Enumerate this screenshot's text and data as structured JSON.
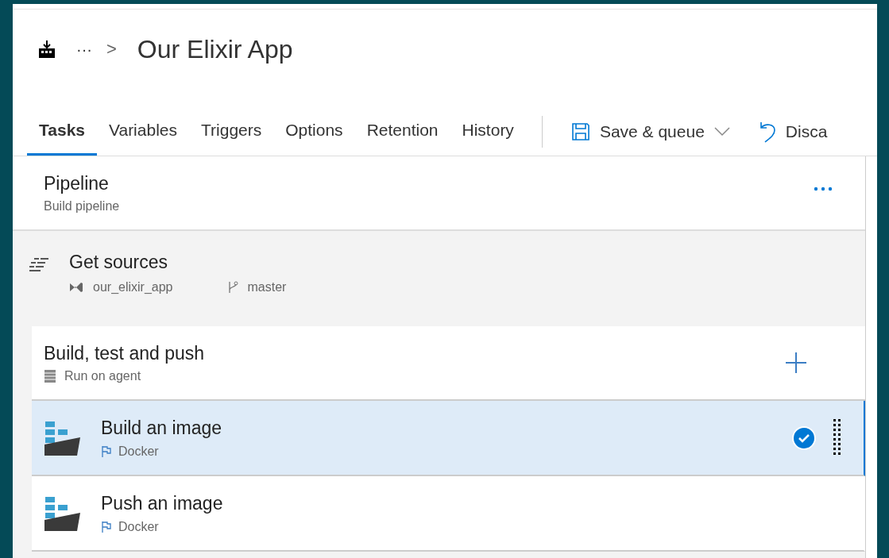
{
  "breadcrumb": {
    "ellipsis": "···",
    "separator": ">",
    "title": "Our Elixir App"
  },
  "tabs": [
    {
      "label": "Tasks",
      "selected": true
    },
    {
      "label": "Variables",
      "selected": false
    },
    {
      "label": "Triggers",
      "selected": false
    },
    {
      "label": "Options",
      "selected": false
    },
    {
      "label": "Retention",
      "selected": false
    },
    {
      "label": "History",
      "selected": false
    }
  ],
  "actions": [
    {
      "kind": "save",
      "label": "Save & queue"
    },
    {
      "kind": "discard",
      "label": "Disca"
    }
  ],
  "pipeline": {
    "title": "Pipeline",
    "subtitle": "Build pipeline"
  },
  "get_sources": {
    "title": "Get sources",
    "repository": "our_elixir_app",
    "branch": "master"
  },
  "job": {
    "title": "Build, test and push",
    "subtitle": "Run on agent"
  },
  "tasks": [
    {
      "name": "Build an image",
      "type": "Docker",
      "selected": true
    },
    {
      "name": "Push an image",
      "type": "Docker",
      "selected": false
    }
  ]
}
